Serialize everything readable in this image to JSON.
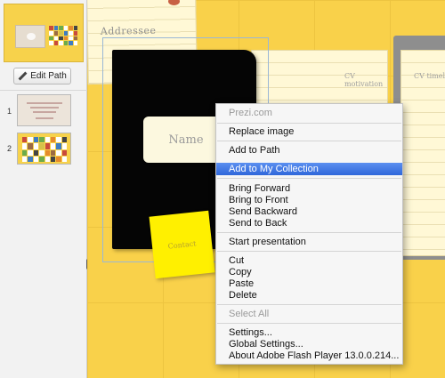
{
  "sidebar": {
    "edit_path_label": "Edit Path",
    "path_items": [
      {
        "number": "1"
      },
      {
        "number": "2"
      }
    ]
  },
  "canvas": {
    "addressee_label": "Addressee",
    "name_label": "Name",
    "contact_label": "Contact",
    "cv_motivation_label": "CV motivation",
    "cv_timeline_label": "CV timeli"
  },
  "context_menu": {
    "header": "Prezi.com",
    "replace_image": "Replace image",
    "add_to_path": "Add to Path",
    "add_to_collection": "Add to My Collection",
    "bring_forward": "Bring Forward",
    "bring_to_front": "Bring to Front",
    "send_backward": "Send Backward",
    "send_to_back": "Send to Back",
    "start_presentation": "Start presentation",
    "cut": "Cut",
    "copy": "Copy",
    "paste": "Paste",
    "delete": "Delete",
    "select_all": "Select All",
    "settings": "Settings...",
    "global_settings": "Global Settings...",
    "about": "About Adobe Flash Player 13.0.0.214..."
  },
  "colors": {
    "canvas_bg": "#f9d14a",
    "menu_highlight": "#3a72e0",
    "notebook": "#050505",
    "sticky_note": "#fff000"
  }
}
